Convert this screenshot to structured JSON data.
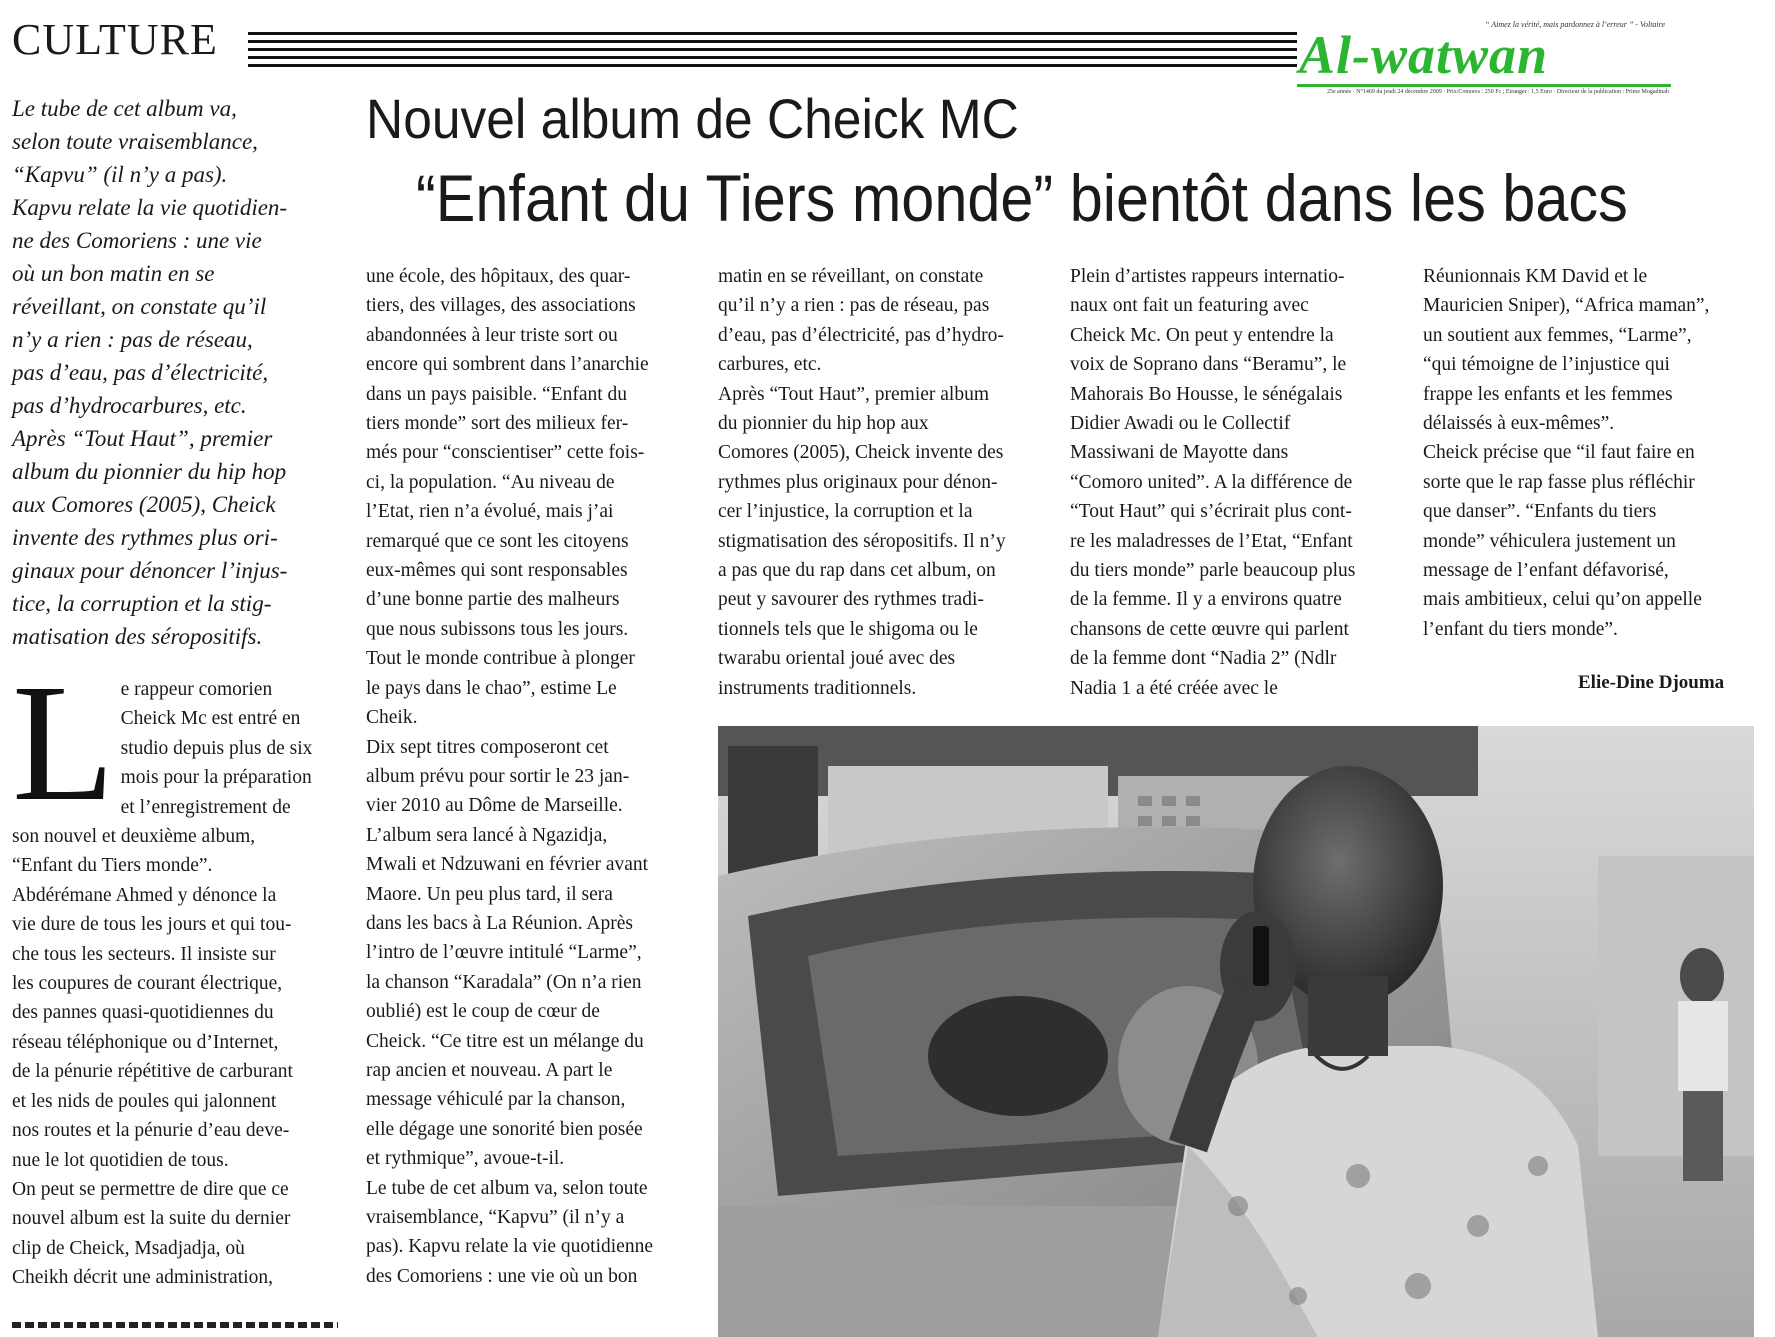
{
  "section": "CULTURE",
  "masthead": {
    "title": "Al-watwan",
    "motto": "“ Aimez la vérité, mais pardonnez à l’erreur ” - Voltaire",
    "info": "25e année · N°1469 du jeudi 24 décembre 2009 · Prix/Comores : 250 Fc ; Etranger : 1,5 Euro · Directeur de la publication : Prime Mogadinah"
  },
  "article": {
    "kicker": "Nouvel album de Cheick MC",
    "headline": "“Enfant du Tiers monde” bientôt dans les bacs",
    "lede": [
      "Le tube de cet album va,",
      "selon toute vraisemblance,",
      "“Kapvu” (il n’y a pas).",
      "Kapvu relate la vie quotidien-",
      "ne des Comoriens : une vie",
      "où un bon matin en se",
      "réveillant, on constate qu’il",
      "n’y a rien : pas de réseau,",
      "pas d’eau, pas d’électricité,",
      "pas d’hydrocarbures, etc.",
      "Après “Tout Haut”, premier",
      "album du pionnier du hip hop",
      "aux Comores (2005), Cheick",
      "invente des rythmes plus ori-",
      "ginaux pour dénoncer l’injus-",
      "tice, la corruption et la stig-",
      "matisation des séropositifs."
    ],
    "dropcap": "L",
    "col1": [
      "e rappeur comorien",
      "Cheick Mc est entré en",
      "studio depuis plus de six",
      "mois pour la préparation",
      "et l’enregistrement de",
      "son nouvel et deuxième album,",
      "“Enfant du Tiers monde”.",
      "Abdérémane Ahmed y dénonce la",
      "vie dure de tous les jours et qui tou-",
      "che tous les secteurs. Il insiste sur",
      "les coupures de courant électrique,",
      "des pannes quasi-quotidiennes du",
      "réseau téléphonique ou d’Internet,",
      "de la pénurie répétitive de carburant",
      "et les nids de poules qui jalonnent",
      "nos routes et la pénurie d’eau deve-",
      "nue le lot quotidien de tous.",
      "On peut se permettre de dire que ce",
      "nouvel album est la suite du dernier",
      "clip de Cheick, Msadjadja, où",
      "Cheikh décrit une administration,"
    ],
    "col2": [
      "une école, des hôpitaux, des quar-",
      "tiers, des villages, des associations",
      "abandonnées à leur triste sort ou",
      "encore qui sombrent dans l’anarchie",
      "dans un pays paisible. “Enfant du",
      "tiers monde” sort des milieux fer-",
      "més pour “conscientiser” cette fois-",
      "ci, la population. “Au niveau de",
      "l’Etat, rien n’a évolué, mais j’ai",
      "remarqué que ce sont les citoyens",
      "eux-mêmes qui sont responsables",
      "d’une bonne partie des malheurs",
      "que nous subissons tous les jours.",
      "Tout le monde contribue à plonger",
      "le pays dans le chao”, estime Le",
      "Cheik.",
      "Dix sept titres composeront cet",
      "album prévu pour sortir le 23 jan-",
      "vier 2010 au Dôme de Marseille.",
      "L’album sera lancé à Ngazidja,",
      "Mwali et Ndzuwani en février avant",
      "Maore. Un peu plus tard, il sera",
      "dans les bacs à La Réunion. Après",
      "l’intro de l’œuvre intitulé “Larme”,",
      "la chanson “Karadala” (On n’a rien",
      "oublié) est le coup de cœur de",
      "Cheick. “Ce titre est un mélange du",
      "rap ancien et nouveau. A part le",
      "message véhiculé par la chanson,",
      "elle dégage une sonorité bien posée",
      "et rythmique”, avoue-t-il.",
      "Le tube de cet album va, selon toute",
      "vraisemblance, “Kapvu” (il n’y a",
      "pas). Kapvu relate la vie quotidienne",
      "des Comoriens : une vie où un bon"
    ],
    "col3": [
      "matin en se réveillant, on constate",
      "qu’il n’y a rien : pas de réseau, pas",
      "d’eau, pas d’électricité, pas d’hydro-",
      "carbures, etc.",
      "Après “Tout Haut”, premier album",
      "du pionnier du hip hop aux",
      "Comores (2005), Cheick invente des",
      "rythmes plus originaux pour dénon-",
      "cer l’injustice, la corruption et la",
      "stigmatisation des séropositifs. Il n’y",
      "a pas que du rap dans cet album, on",
      "peut y savourer des rythmes tradi-",
      "tionnels tels que le shigoma ou le",
      "twarabu oriental joué avec des",
      "instruments traditionnels."
    ],
    "col4": [
      "Plein d’artistes rappeurs internatio-",
      "naux ont fait un featuring avec",
      "Cheick Mc. On peut y entendre la",
      "voix de Soprano dans “Beramu”, le",
      "Mahorais Bo Housse, le sénégalais",
      "Didier Awadi ou le Collectif",
      "Massiwani de Mayotte dans",
      "“Comoro united”. A la différence de",
      "“Tout Haut” qui s’écrirait plus cont-",
      "re les maladresses de l’Etat, “Enfant",
      "du tiers monde” parle beaucoup plus",
      "de la femme. Il y a environs quatre",
      "chansons de cette œuvre qui parlent",
      "de la femme dont “Nadia 2” (Ndlr",
      "Nadia 1 a été créée avec le"
    ],
    "col5": [
      "Réunionnais KM David et le",
      "Mauricien Sniper), “Africa maman”,",
      "un soutient aux femmes, “Larme”,",
      "“qui témoigne de l’injustice qui",
      "frappe les enfants et les femmes",
      "délaissés à eux-mêmes”.",
      "Cheick précise que “il faut faire en",
      "sorte que le rap fasse plus réfléchir",
      "que danser”. “Enfants du tiers",
      "monde” véhiculera justement un",
      "message de l’enfant défavorisé,",
      "mais ambitieux, celui qu’on appelle",
      "l’enfant du tiers monde”."
    ],
    "byline": "Elie-Dine Djouma"
  },
  "colors": {
    "masthead_green": "#2bb531",
    "ink": "#1a1a1a"
  },
  "photo": {
    "subject": "Cheick MC on phone beside a car"
  }
}
